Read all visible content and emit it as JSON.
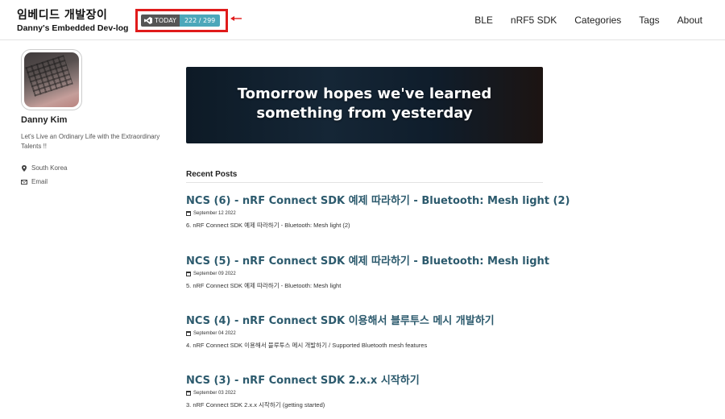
{
  "site": {
    "title": "임베디드 개발장이",
    "subtitle": "Danny's Embedded Dev-log"
  },
  "hits": {
    "label": "TODAY",
    "count": "222 / 299"
  },
  "nav": {
    "items": [
      "BLE",
      "nRF5 SDK",
      "Categories",
      "Tags",
      "About"
    ]
  },
  "author": {
    "name": "Danny Kim",
    "bio": "Let's Live an Ordinary Life with the Extraordinary Talents !!",
    "location": "South Korea",
    "email_label": "Email"
  },
  "banner": {
    "line1": "Tomorrow hopes we've learned",
    "line2": "something from yesterday"
  },
  "recent": {
    "heading": "Recent Posts",
    "posts": [
      {
        "title": "NCS (6) - nRF Connect SDK 예제 따라하기 - Bluetooth: Mesh light (2)",
        "date": "September 12 2022",
        "excerpt": "6. nRF Connect SDK 예제 따라하기 - Bluetooth: Mesh light (2)"
      },
      {
        "title": "NCS (5) - nRF Connect SDK 예제 따라하기 - Bluetooth: Mesh light",
        "date": "September 09 2022",
        "excerpt": "5. nRF Connect SDK 예제 따라하기 - Bluetooth: Mesh light"
      },
      {
        "title": "NCS (4) - nRF Connect SDK 이용해서 블루투스 메시 개발하기",
        "date": "September 04 2022",
        "excerpt": "4. nRF Connect SDK 이용해서 블루투스 메시 개발하기 / Supported Bluetooth mesh features"
      },
      {
        "title": "NCS (3) - nRF Connect SDK 2.x.x 시작하기",
        "date": "September 03 2022",
        "excerpt": "3. nRF Connect SDK 2.x.x 시작하기 (getting started)"
      }
    ]
  },
  "colors": {
    "post_title": "#2c5a6d",
    "highlight_box": "#e01b1b",
    "hits_count_bg": "#4ca7ba"
  }
}
